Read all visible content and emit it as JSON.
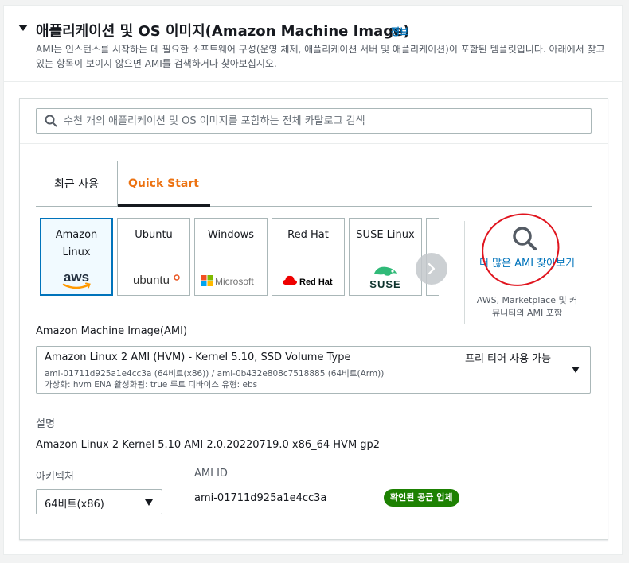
{
  "header": {
    "title": "애플리케이션 및 OS 이미지(Amazon Machine Image)",
    "info_link": "정보",
    "description": "AMI는 인스턴스를 시작하는 데 필요한 소프트웨어 구성(운영 체제, 애플리케이션 서버 및 애플리케이션)이 포함된 템플릿입니다. 아래에서 찾고 있는 항목이 보이지 않으면 AMI를 검색하거나 찾아보십시오."
  },
  "search": {
    "placeholder": "수천 개의 애플리케이션 및 OS 이미지를 포함하는 전체 카탈로그 검색",
    "value": ""
  },
  "tabs": [
    {
      "label": "최근 사용",
      "active": false
    },
    {
      "label": "Quick Start",
      "active": true
    }
  ],
  "os_cards": [
    {
      "name": "Amazon Linux",
      "logo": "aws",
      "selected": true
    },
    {
      "name": "Ubuntu",
      "logo": "ubuntu",
      "selected": false
    },
    {
      "name": "Windows",
      "logo": "Microsoft",
      "selected": false
    },
    {
      "name": "Red Hat",
      "logo": "Red Hat",
      "selected": false
    },
    {
      "name": "SUSE Linux",
      "logo": "SUSE",
      "selected": false
    }
  ],
  "browse_more": {
    "link": "더 많은 AMI 찾아보기",
    "subtext": "AWS, Marketplace 및 커뮤니티의 AMI 포함"
  },
  "ami": {
    "label": "Amazon Machine Image(AMI)",
    "name": "Amazon Linux 2 AMI (HVM) - Kernel 5.10, SSD Volume Type",
    "ids": "ami-01711d925a1e4cc3a (64비트(x86)) / ami-0b432e808c7518885 (64비트(Arm))",
    "meta": "가상화: hvm     ENA 활성화됨: true     루트 디바이스 유형: ebs",
    "free_tier": "프리 티어 사용 가능"
  },
  "description_section": {
    "label": "설명",
    "value": "Amazon Linux 2 Kernel 5.10 AMI 2.0.20220719.0 x86_64 HVM gp2"
  },
  "architecture": {
    "label": "아키텍처",
    "value": "64비트(x86)"
  },
  "ami_id": {
    "label": "AMI ID",
    "value": "ami-01711d925a1e4cc3a",
    "badge": "확인된 공급 업체"
  },
  "colors": {
    "link": "#0073bb",
    "active_tab": "#ec7211",
    "badge": "#1d8102",
    "annotation": "#e0141e"
  }
}
